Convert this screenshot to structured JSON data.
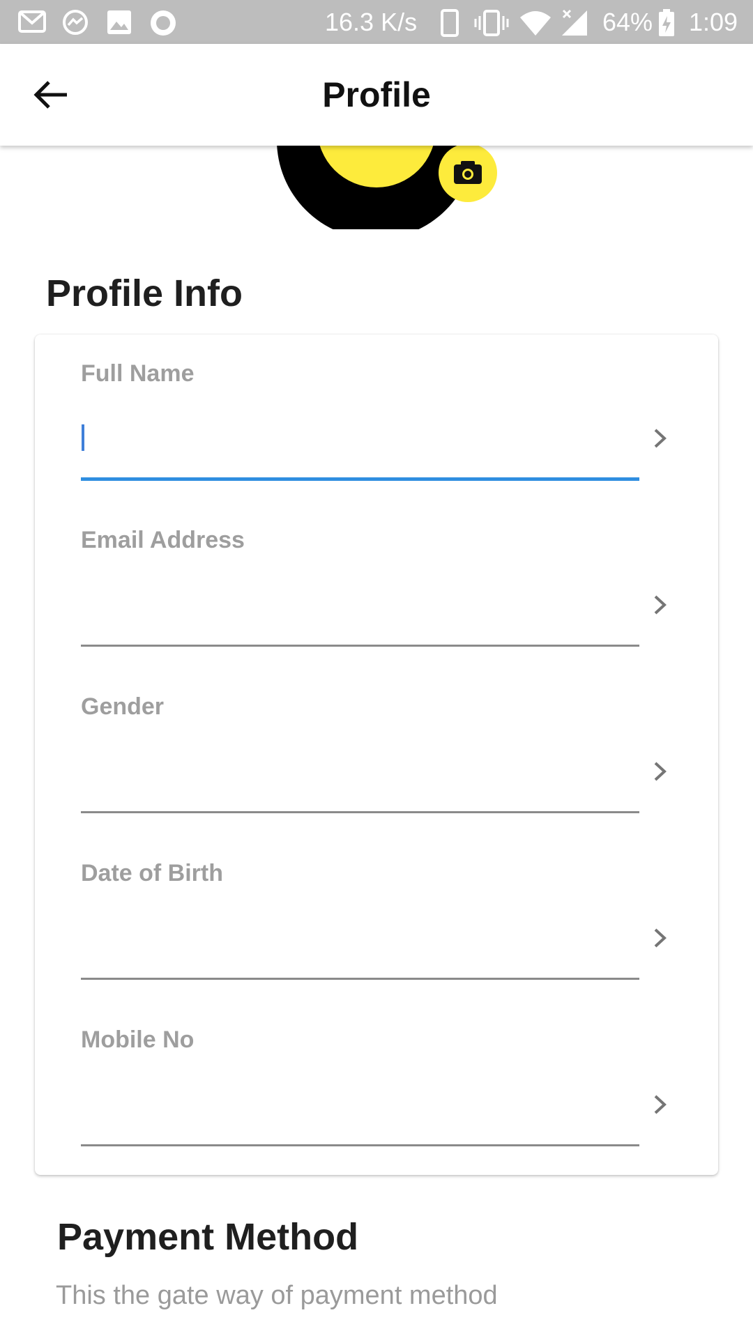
{
  "status_bar": {
    "speed": "16.3 K/s",
    "battery": "64%",
    "time": "1:09",
    "left_icons": [
      "gmail-icon",
      "messenger-icon",
      "gallery-icon",
      "record-icon"
    ],
    "right_icons": [
      "phone-icon",
      "vibrate-icon",
      "wifi-icon",
      "signal-icon",
      "battery-icon"
    ]
  },
  "app_bar": {
    "title": "Profile",
    "back_icon": "arrow-left-icon"
  },
  "avatar": {
    "ring_color": "#000000",
    "fill_color": "#fdeb3c",
    "camera_icon": "camera-icon"
  },
  "profile_info": {
    "heading": "Profile Info",
    "fields": [
      {
        "label": "Full Name",
        "value": "",
        "focused": true
      },
      {
        "label": "Email Address",
        "value": "",
        "focused": false
      },
      {
        "label": "Gender",
        "value": "",
        "focused": false
      },
      {
        "label": "Date of Birth",
        "value": "",
        "focused": false
      },
      {
        "label": "Mobile No",
        "value": "",
        "focused": false
      }
    ]
  },
  "payment": {
    "heading": "Payment Method",
    "subtitle": "This the gate way of payment method"
  },
  "colors": {
    "accent": "#fdeb3c",
    "focus_underline": "#2f8ee0",
    "status_bar_bg": "#bdbdbd",
    "label_gray": "#9e9e9e"
  }
}
